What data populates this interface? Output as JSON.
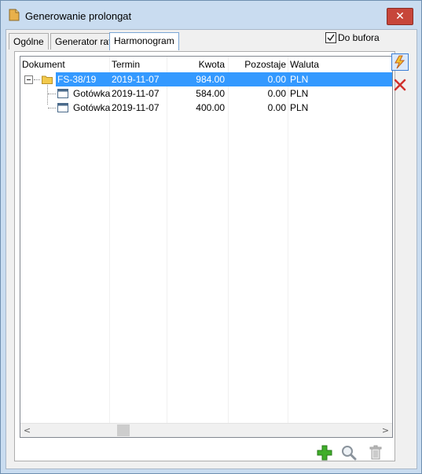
{
  "window": {
    "title": "Generowanie prolongat",
    "close_symbol": "✕"
  },
  "tabs": [
    {
      "label": "Ogólne"
    },
    {
      "label": "Generator rat"
    },
    {
      "label": "Harmonogram",
      "active": true
    }
  ],
  "do_bufora": {
    "label": "Do bufora",
    "checked": true
  },
  "grid": {
    "columns": [
      "Dokument",
      "Termin",
      "Kwota",
      "Pozostaje",
      "Waluta"
    ],
    "rows": [
      {
        "dokument": "FS-38/19",
        "termin": "2019-11-07",
        "kwota": "984.00",
        "pozostaje": "0.00",
        "waluta": "PLN",
        "selected": true,
        "expanded": true
      },
      {
        "dokument": "Gotówka",
        "termin": "2019-11-07",
        "kwota": "584.00",
        "pozostaje": "0.00",
        "waluta": "PLN"
      },
      {
        "dokument": "Gotówka",
        "termin": "2019-11-07",
        "kwota": "400.00",
        "pozostaje": "0.00",
        "waluta": "PLN"
      }
    ],
    "scroll_left": "<",
    "scroll_right": ">"
  },
  "icons": {
    "title": "document-icon",
    "generate": "lightning-icon",
    "delete": "red-x-icon",
    "add": "green-plus-icon",
    "preview": "magnifier-icon",
    "trash": "trash-icon"
  },
  "colors": {
    "selection": "#3399ff",
    "window_frame": "#c9dcf0",
    "close_button": "#c7463a"
  }
}
